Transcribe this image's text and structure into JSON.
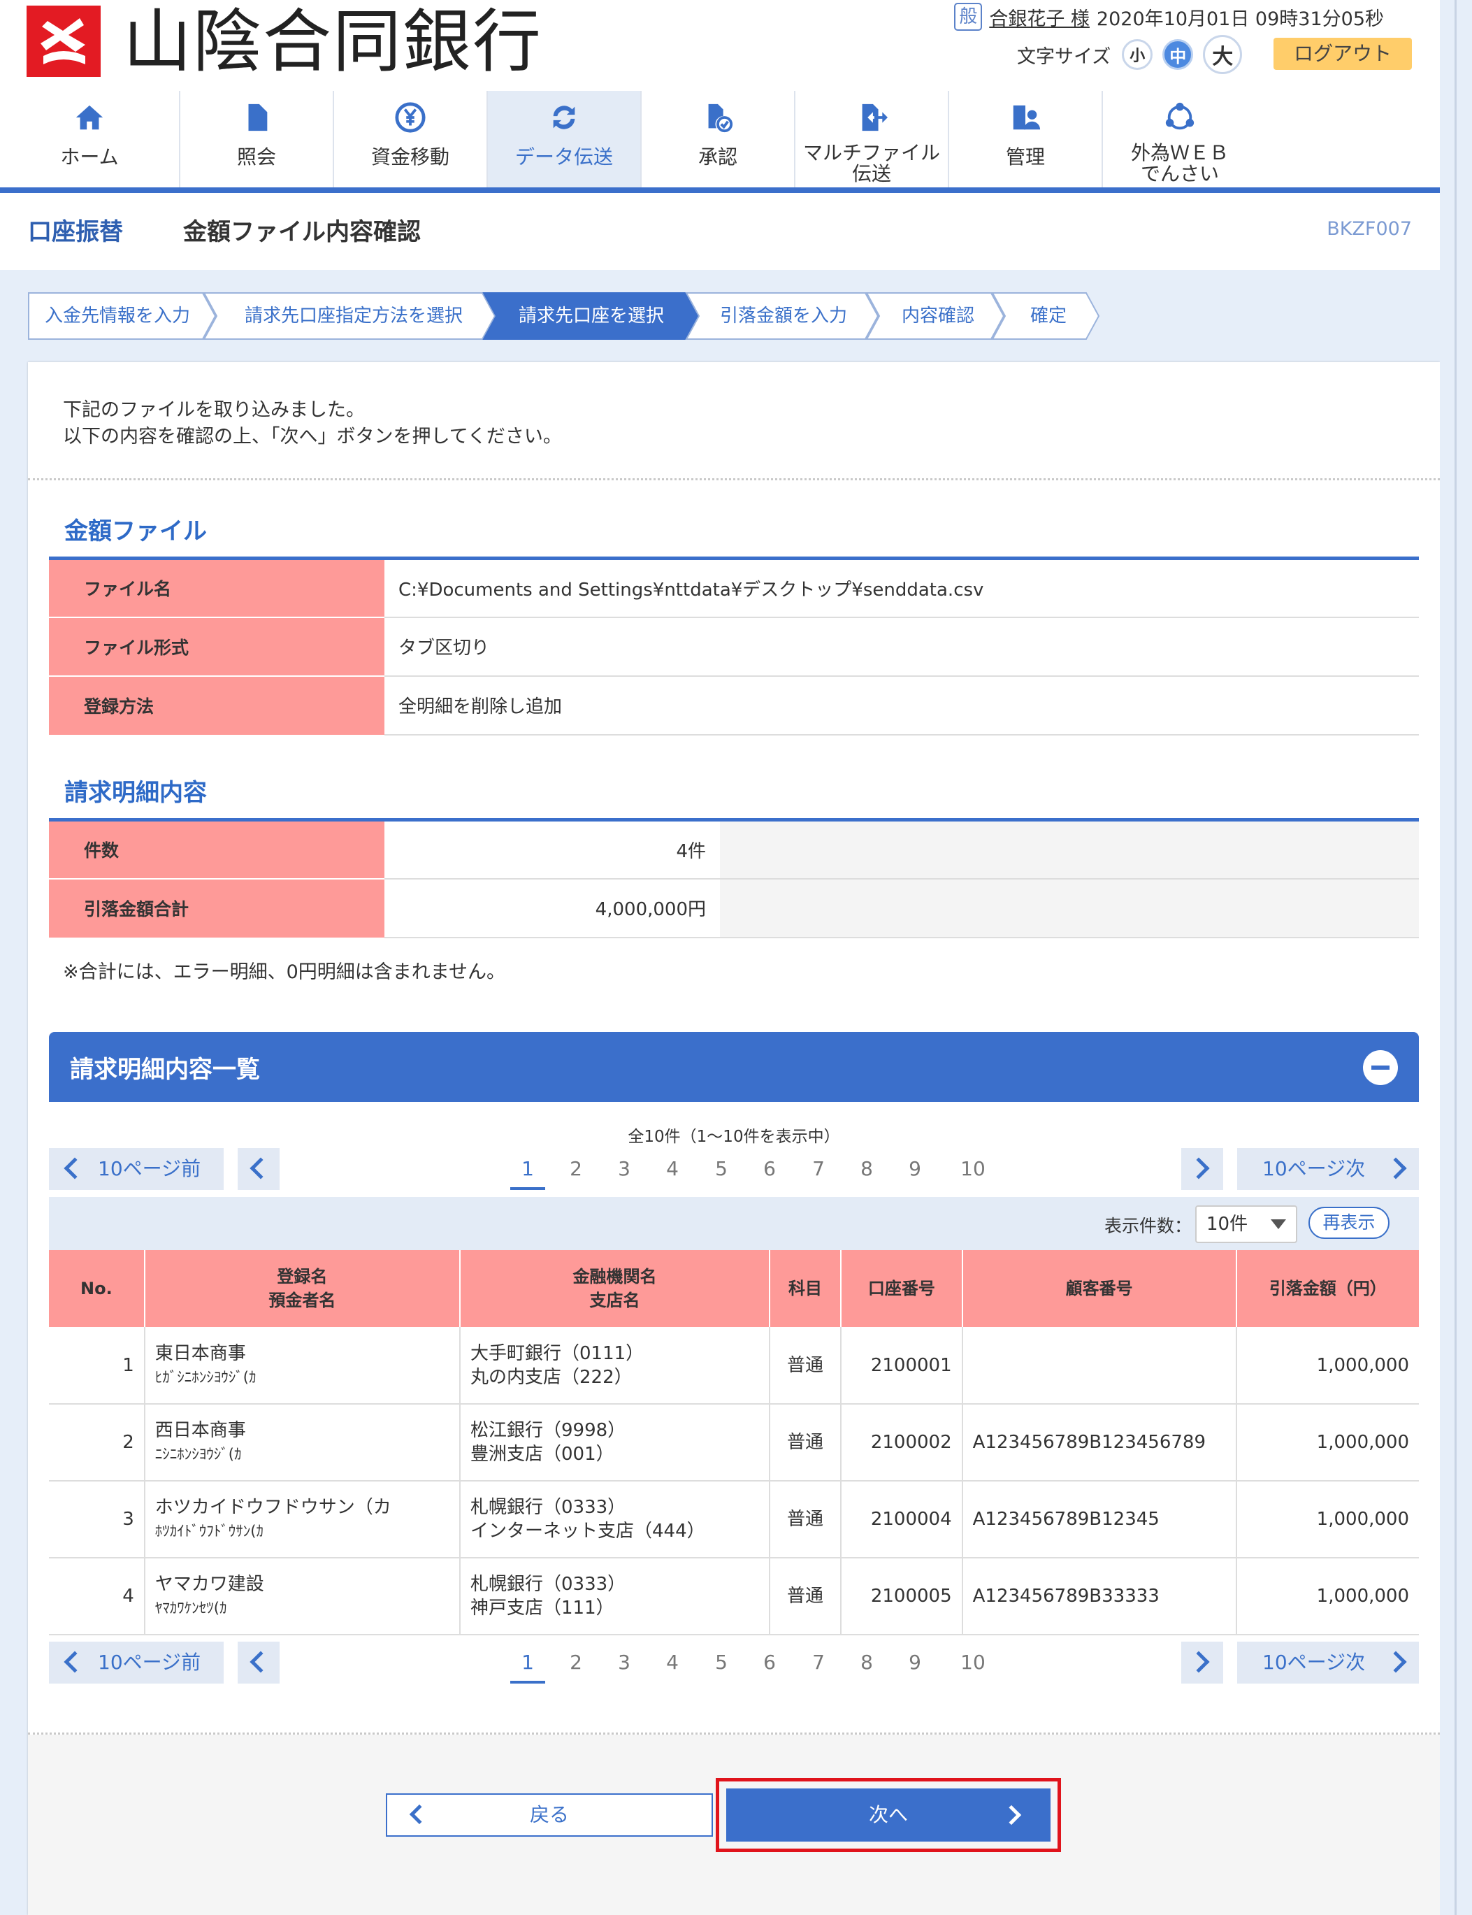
{
  "bank": {
    "name": "山陰合同銀行"
  },
  "user": {
    "badge": "般",
    "name": "合銀花子 様",
    "datetime": "2020年10月01日 09時31分05秒"
  },
  "font_size": {
    "label": "文字サイズ",
    "small": "小",
    "medium": "中",
    "large": "大",
    "selected": "中"
  },
  "logout_label": "ログアウト",
  "nav": {
    "items": [
      {
        "label": "ホーム",
        "icon": "home-icon"
      },
      {
        "label": "照会",
        "icon": "document-icon"
      },
      {
        "label": "資金移動",
        "icon": "yen-transfer-icon"
      },
      {
        "label": "データ伝送",
        "icon": "refresh-icon"
      },
      {
        "label": "承認",
        "icon": "approve-icon"
      },
      {
        "label": "マルチファイル\n伝送",
        "icon": "file-send-icon"
      },
      {
        "label": "管理",
        "icon": "admin-icon"
      },
      {
        "label": "外為ＷＥＢ\nでんさい",
        "icon": "network-icon"
      }
    ],
    "active": "データ伝送"
  },
  "title": {
    "main": "口座振替",
    "sub": "金額ファイル内容確認",
    "screen_id": "BKZF007"
  },
  "steps": [
    "入金先情報を入力",
    "請求先口座指定方法を選択",
    "請求先口座を選択",
    "引落金額を入力",
    "内容確認",
    "確定"
  ],
  "active_step": "請求先口座を選択",
  "intro": {
    "line1": "下記のファイルを取り込みました。",
    "line2": "以下の内容を確認の上、「次へ」ボタンを押してください。"
  },
  "amount_file": {
    "title": "金額ファイル",
    "file_name_label": "ファイル名",
    "file_name": "C:¥Documents and Settings¥nttdata¥デスクトップ¥senddata.csv",
    "format_label": "ファイル形式",
    "format": "タブ区切り",
    "method_label": "登録方法",
    "method": "全明細を削除し追加"
  },
  "summary": {
    "title": "請求明細内容",
    "count_label": "件数",
    "count": "4件",
    "total_label": "引落金額合計",
    "total": "4,000,000円",
    "note": "※合計には、エラー明細、0円明細は含まれません。"
  },
  "list": {
    "title": "請求明細内容一覧",
    "count_text": "全10件（1～10件を表示中）",
    "pager": {
      "prev10": "10ページ前",
      "next10": "10ページ次",
      "pages": [
        "1",
        "2",
        "3",
        "4",
        "5",
        "6",
        "7",
        "8",
        "9",
        "10"
      ],
      "current": "1"
    },
    "display_label": "表示件数：",
    "display_value": "10件",
    "redisplay_label": "再表示",
    "headers": {
      "no": "No.",
      "name1": "登録名",
      "name2": "預金者名",
      "bank1": "金融機関名",
      "bank2": "支店名",
      "type": "科目",
      "account": "口座番号",
      "customer": "顧客番号",
      "amount": "引落金額（円）"
    },
    "rows": [
      {
        "no": "1",
        "name": "東日本商事",
        "kana": "ﾋｶﾞｼﾆﾎﾝｼﾖｳｼﾞ(ｶ",
        "bank": "大手町銀行（0111）",
        "branch": "丸の内支店（222）",
        "type": "普通",
        "account": "2100001",
        "customer": "",
        "amount": "1,000,000"
      },
      {
        "no": "2",
        "name": "西日本商事",
        "kana": "ﾆｼﾆﾎﾝｼﾖｳｼﾞ(ｶ",
        "bank": "松江銀行（9998）",
        "branch": "豊洲支店（001）",
        "type": "普通",
        "account": "2100002",
        "customer": "A123456789B123456789",
        "amount": "1,000,000"
      },
      {
        "no": "3",
        "name": "ホツカイドウフドウサン（カ",
        "kana": "ﾎﾂｶｲﾄﾞｳﾌﾄﾞｳｻﾝ(ｶ",
        "bank": "札幌銀行（0333）",
        "branch": "インターネット支店（444）",
        "type": "普通",
        "account": "2100004",
        "customer": "A123456789B12345",
        "amount": "1,000,000"
      },
      {
        "no": "4",
        "name": "ヤマカワ建設",
        "kana": "ﾔﾏｶﾜｹﾝｾﾂ(ｶ",
        "bank": "札幌銀行（0333）",
        "branch": "神戸支店（111）",
        "type": "普通",
        "account": "2100005",
        "customer": "A123456789B33333",
        "amount": "1,000,000"
      }
    ]
  },
  "buttons": {
    "back": "戻る",
    "next": "次へ"
  },
  "colors": {
    "brand_blue": "#3b6fcb",
    "header_pink": "#fe9a98",
    "logo_red": "#e31b23",
    "highlight_red": "#e0141c"
  }
}
